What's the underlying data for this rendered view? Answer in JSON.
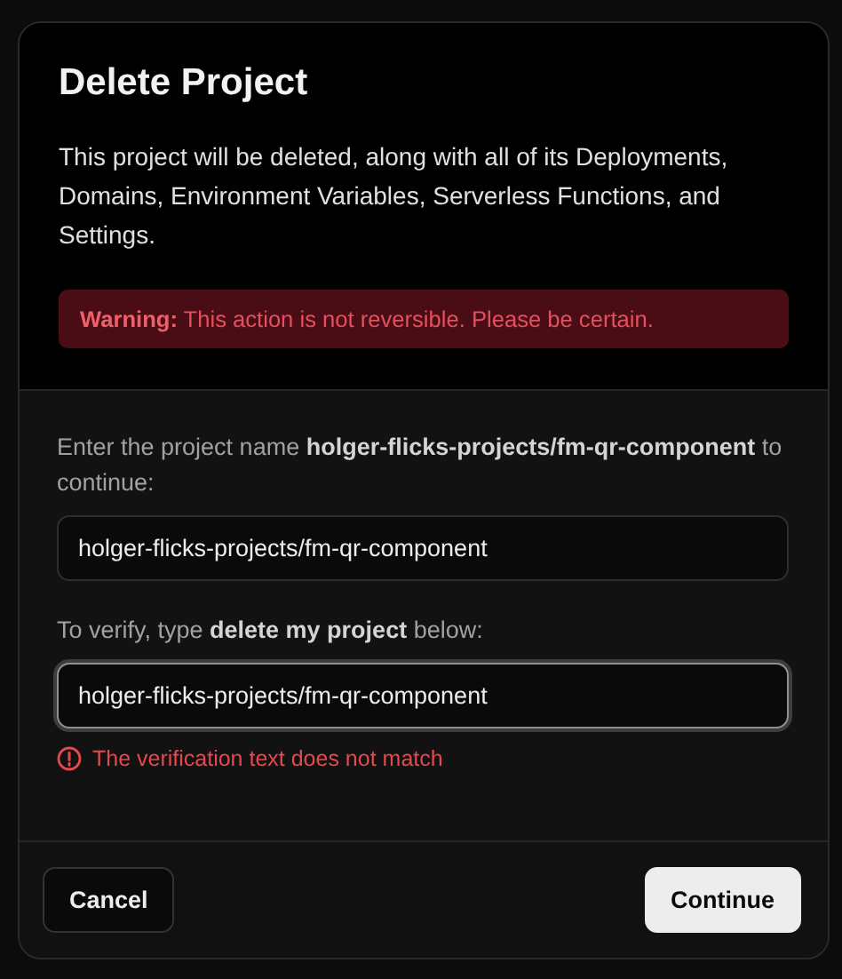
{
  "dialog": {
    "title": "Delete Project",
    "description": "This project will be deleted, along with all of its Deployments, Domains, Environment Variables, Serverless Functions, and Settings.",
    "warning": "**Warning:** This action is not reversible. Please be certain.",
    "fields": [
      {
        "label": "Enter the project name **holger-flicks-projects/fm-qr-component** to continue:",
        "value": "holger-flicks-projects/fm-qr-component",
        "focused": false
      },
      {
        "label": "To verify, type **delete my project** below:",
        "value": "holger-flicks-projects/fm-qr-component",
        "focused": true
      }
    ],
    "error": "The verification text does not match",
    "buttons": [
      {
        "label": "Cancel",
        "kind": "secondary"
      },
      {
        "label": "Continue",
        "kind": "primary"
      }
    ]
  }
}
